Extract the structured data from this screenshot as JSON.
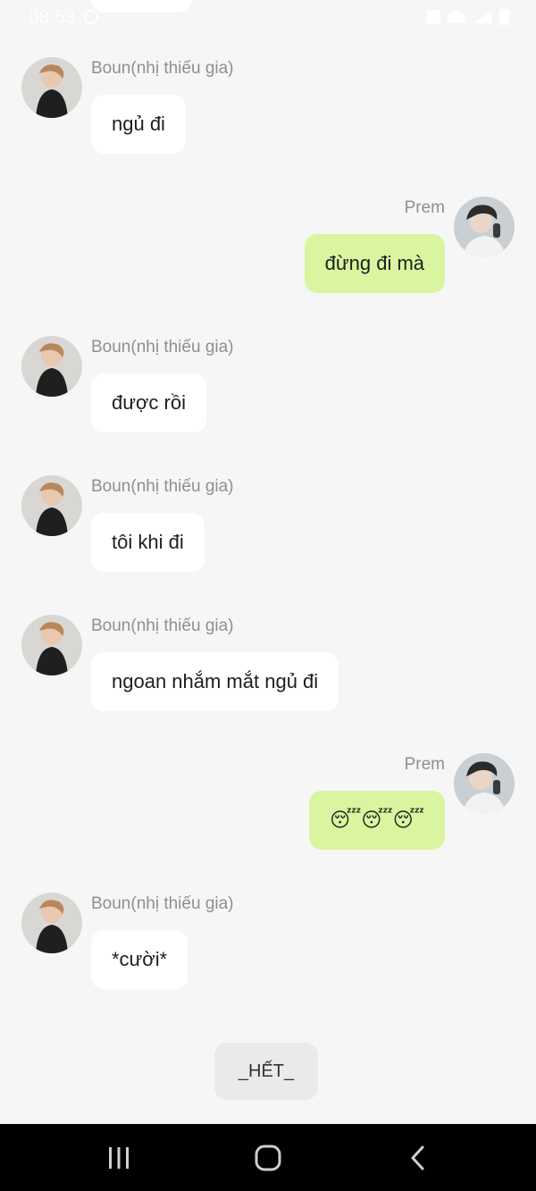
{
  "status_bar": {
    "time": "08:53"
  },
  "messages": [
    {
      "side": "left",
      "sender": "Boun(nhị thiếu gia)",
      "text": "ngủ đi"
    },
    {
      "side": "right",
      "sender": "Prem",
      "text": "đừng đi mà"
    },
    {
      "side": "left",
      "sender": "Boun(nhị thiếu gia)",
      "text": "được rồi"
    },
    {
      "side": "left",
      "sender": "Boun(nhị thiếu gia)",
      "text": "tôi khi đi"
    },
    {
      "side": "left",
      "sender": "Boun(nhị thiếu gia)",
      "text": "ngoan nhắm mắt ngủ đi"
    },
    {
      "side": "right",
      "sender": "Prem",
      "text": "😴😴😴"
    },
    {
      "side": "left",
      "sender": "Boun(nhị thiếu gia)",
      "text": "*cười*"
    }
  ],
  "end_label": "_HẾT_",
  "colors": {
    "background": "#f6f6f6",
    "left_bubble": "#ffffff",
    "right_bubble": "#d9f59f",
    "sender_text": "#8f8f8f",
    "nav_bar": "#000000"
  },
  "icons": {
    "nav_recent": "recent-apps-icon",
    "nav_home": "home-icon",
    "nav_back": "back-icon"
  }
}
